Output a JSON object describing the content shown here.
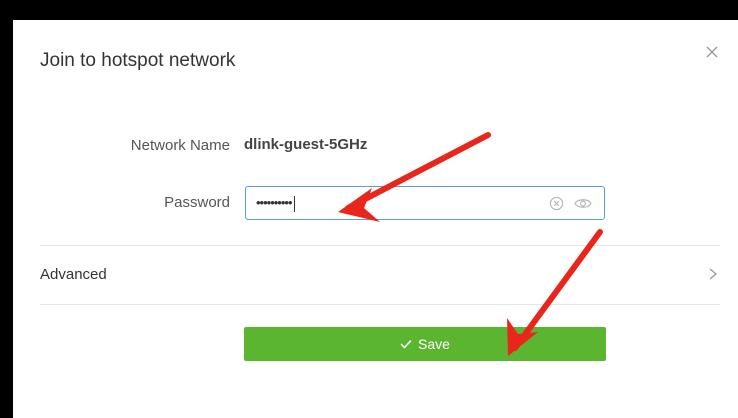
{
  "dialog": {
    "title": "Join to hotspot network",
    "close_icon": "close-icon"
  },
  "form": {
    "network_name_label": "Network Name",
    "network_name_value": "dlink-guest-5GHz",
    "password_label": "Password",
    "password_mask": "••••••••••"
  },
  "advanced": {
    "label": "Advanced",
    "icon": "chevron-right-icon"
  },
  "save": {
    "label": "Save",
    "icon": "check-icon"
  },
  "colors": {
    "save_button": "#5cb531",
    "input_border": "#5a9fd4",
    "annotation_arrow": "#e8261c"
  }
}
